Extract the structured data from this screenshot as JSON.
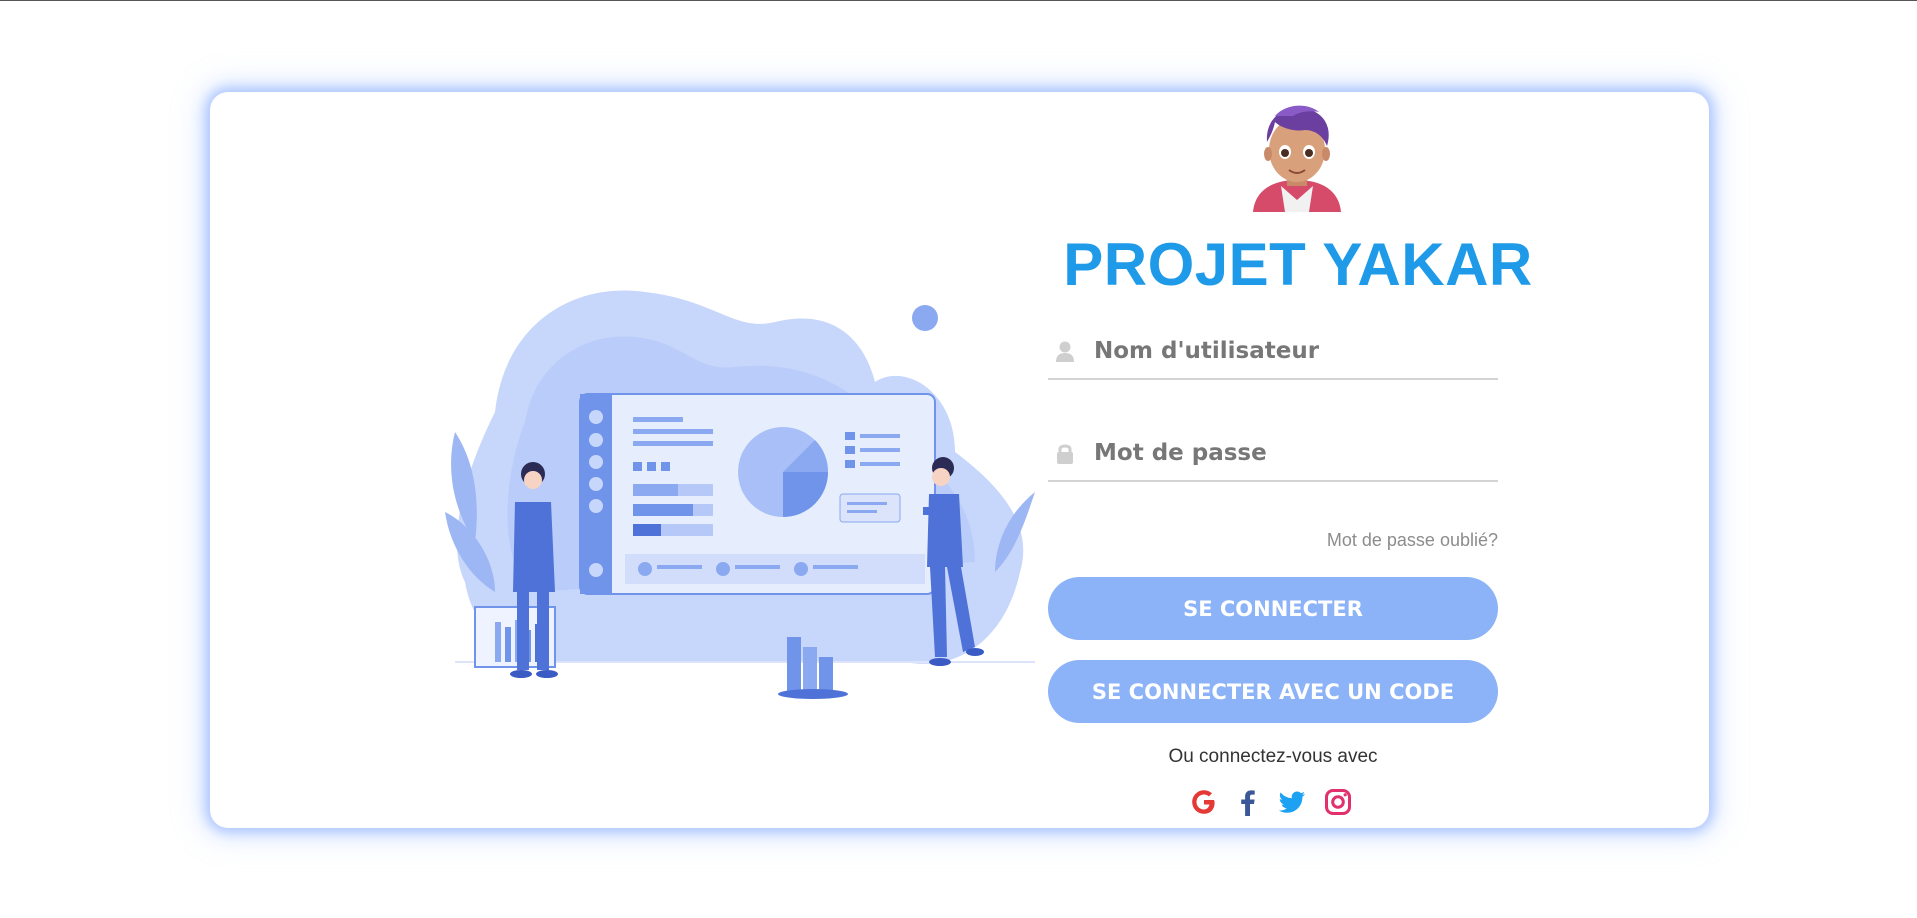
{
  "app": {
    "title": "PROJET YAKAR"
  },
  "form": {
    "username_placeholder": "Nom d'utilisateur",
    "password_placeholder": "Mot de passe",
    "forgot_password": "Mot de passe oublié?",
    "login_button": "SE CONNECTER",
    "code_login_button": "SE CONNECTER AVEC UN CODE",
    "alt_login_text": "Ou connectez-vous avec"
  },
  "socials": [
    {
      "name": "google-icon",
      "color": "#e53935"
    },
    {
      "name": "facebook-icon",
      "color": "#3b5998"
    },
    {
      "name": "twitter-icon",
      "color": "#1da1f2"
    },
    {
      "name": "instagram-icon",
      "color": "#e1306c"
    }
  ],
  "colors": {
    "accent": "#1e9ae8",
    "button": "#8cb3f7",
    "illustration": "#6f94ea"
  }
}
